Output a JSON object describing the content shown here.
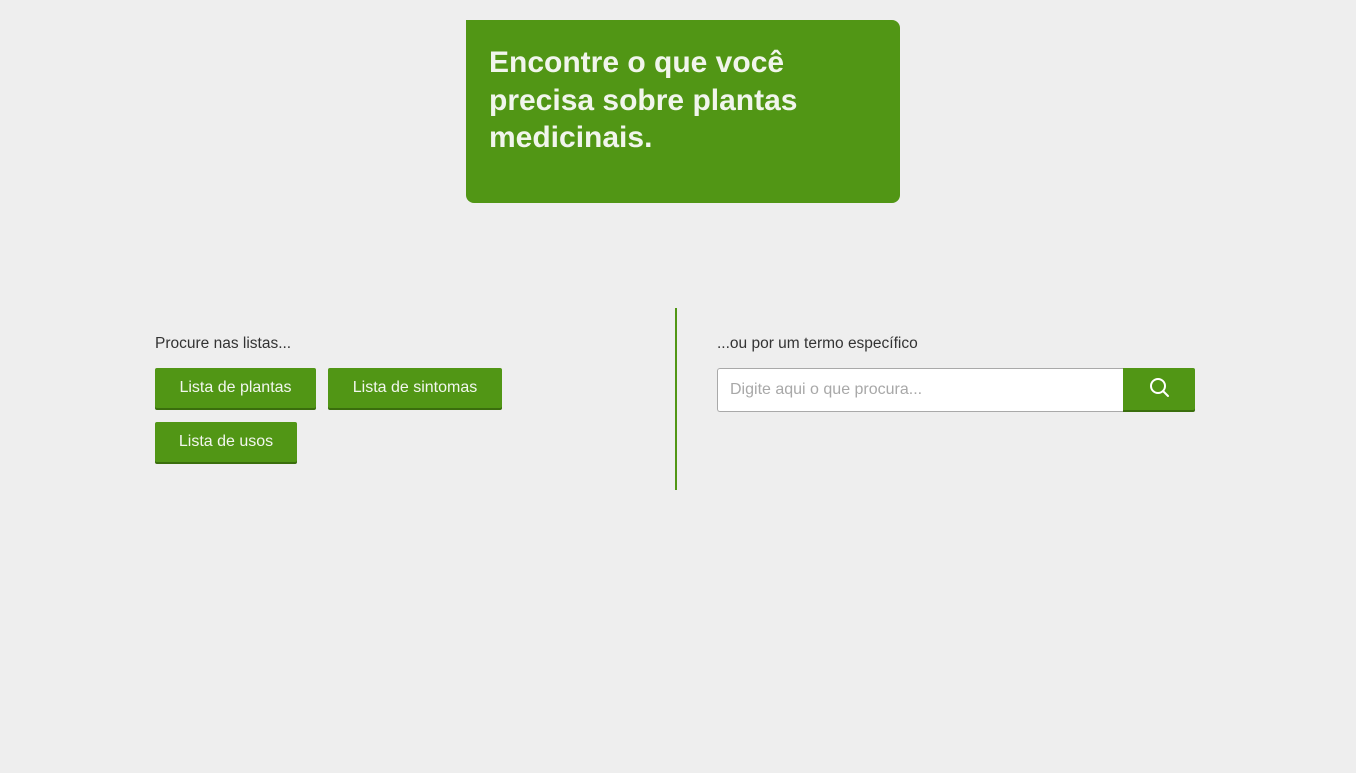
{
  "hero": {
    "title": "Encontre o que você precisa sobre plantas medicinais."
  },
  "lists": {
    "label": "Procure nas listas...",
    "buttons": [
      "Lista de plantas",
      "Lista de sintomas",
      "Lista de usos"
    ]
  },
  "search": {
    "label": "...ou por um termo específico",
    "placeholder": "Digite aqui o que procura...",
    "value": "",
    "button_icon": "search-icon"
  },
  "colors": {
    "accent": "#519615",
    "background": "#eeeeee",
    "hero_text": "#f1f5ec"
  }
}
